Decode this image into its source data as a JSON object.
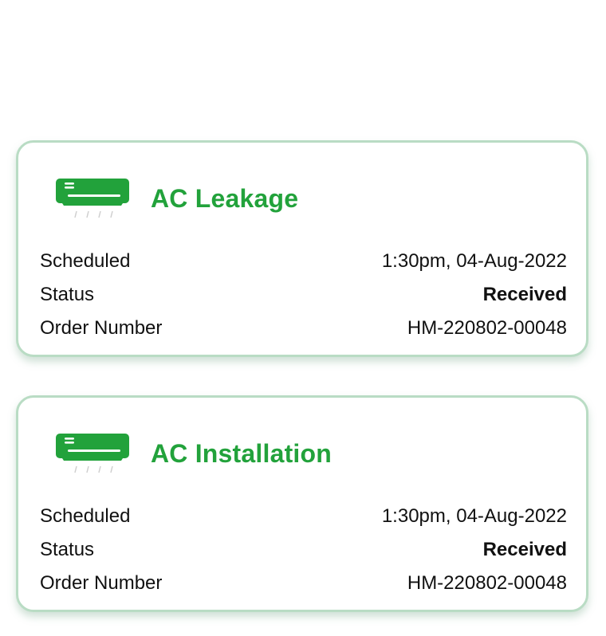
{
  "orders": [
    {
      "title": "AC Leakage",
      "icon": "air-conditioner-icon",
      "scheduled_label": "Scheduled",
      "scheduled_value": "1:30pm, 04-Aug-2022",
      "status_label": "Status",
      "status_value": "Received",
      "order_label": "Order Number",
      "order_value": "HM-220802-00048"
    },
    {
      "title": "AC Installation",
      "icon": "air-conditioner-icon",
      "scheduled_label": "Scheduled",
      "scheduled_value": "1:30pm, 04-Aug-2022",
      "status_label": "Status",
      "status_value": "Received",
      "order_label": "Order Number",
      "order_value": "HM-220802-00048"
    }
  ],
  "colors": {
    "accent": "#22a23b",
    "card_border": "#b9dcc4",
    "text": "#111111"
  }
}
